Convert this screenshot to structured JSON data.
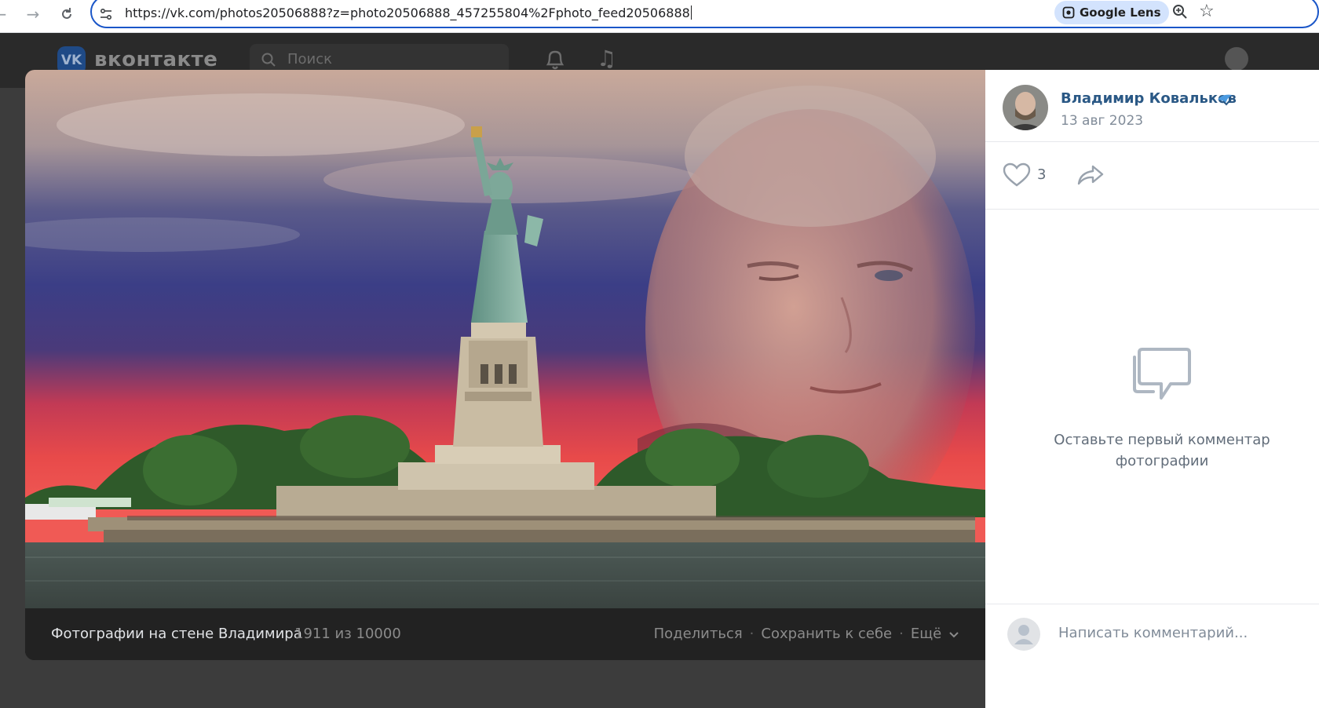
{
  "browser": {
    "url": "https://vk.com/photos20506888?z=photo20506888_457255804%2Fphoto_feed20506888",
    "lens_label": "Google Lens",
    "back_icon": "arrow-left-icon",
    "forward_icon": "arrow-right-icon",
    "reload_icon": "reload-icon",
    "zoom_icon": "zoom-icon",
    "bookmark_icon": "star-icon"
  },
  "vk_header": {
    "logo_text": "вконтакте",
    "search_placeholder": "Поиск"
  },
  "viewer": {
    "album_title": "Фотографии на стене Владимира",
    "counter": "1911 из 10000",
    "share_label": "Поделиться",
    "save_label": "Сохранить к себе",
    "more_label": "Ещё",
    "separator": "·"
  },
  "side": {
    "author_name": "Владимир Ковальков",
    "date": "13 авг 2023",
    "likes": "3",
    "empty_text_line1": "Оставьте первый комментар",
    "empty_text_line2": "фотографии",
    "comment_placeholder": "Написать комментарий..."
  },
  "colors": {
    "accent_blue": "#2a5885",
    "omnibox_border": "#1a56c8",
    "lens_pill": "#d3e3fd"
  }
}
